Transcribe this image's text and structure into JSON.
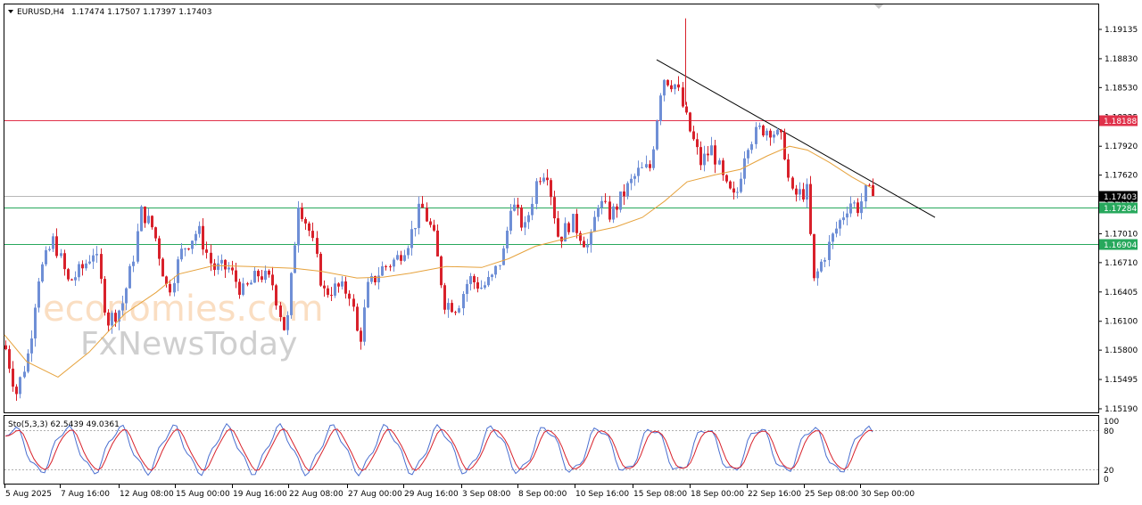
{
  "header": {
    "symbol": "EURUSD,H4",
    "ohlc": "1.17474 1.17507 1.17397 1.17403"
  },
  "watermark": {
    "line1": "economies.com",
    "line2": "FxNewsToday"
  },
  "oscillator": {
    "label": "Sto(5,3,3) 62.5439 49.0361",
    "levels": [
      "100",
      "80",
      "20",
      "0"
    ]
  },
  "colors": {
    "bull": "#6f8fd6",
    "bear": "#d8212b",
    "ma": "#e6a23c",
    "resistance_line": "#e0314a",
    "support_line": "#27a85c",
    "trendline": "#000000",
    "stoch_main": "#4a6fd0",
    "stoch_signal": "#d8212b"
  },
  "chart_data": {
    "type": "candlestick",
    "title": "EURUSD,H4",
    "y_ticks": [
      "1.19135",
      "1.18830",
      "1.18530",
      "1.18225",
      "1.17920",
      "1.17620",
      "1.17315",
      "1.17010",
      "1.16710",
      "1.16405",
      "1.16100",
      "1.15800",
      "1.15495",
      "1.15190"
    ],
    "x_ticks": [
      "5 Aug 2025",
      "7 Aug 16:00",
      "12 Aug 08:00",
      "15 Aug 00:00",
      "19 Aug 16:00",
      "22 Aug 08:00",
      "27 Aug 00:00",
      "29 Aug 16:00",
      "3 Sep 08:00",
      "8 Sep 00:00",
      "10 Sep 16:00",
      "15 Sep 08:00",
      "18 Sep 00:00",
      "22 Sep 16:00",
      "25 Sep 08:00",
      "30 Sep 00:00"
    ],
    "price_labels": [
      {
        "label": "1.18188",
        "value": 1.18188,
        "kind": "resistance"
      },
      {
        "label": "1.17403",
        "value": 1.17403,
        "kind": "current"
      },
      {
        "label": "1.17284",
        "value": 1.17284,
        "kind": "support"
      },
      {
        "label": "1.16904",
        "value": 1.16904,
        "kind": "support"
      }
    ],
    "trendline": {
      "from_x": 736,
      "from_price": 1.1882,
      "to_x": 1048,
      "to_price": 1.1718
    },
    "ylim": [
      1.1508,
      1.1938
    ],
    "keypoints": [
      [
        5,
        1.1585
      ],
      [
        18,
        1.1535
      ],
      [
        32,
        1.158
      ],
      [
        42,
        1.1655
      ],
      [
        60,
        1.1695
      ],
      [
        76,
        1.165
      ],
      [
        92,
        1.1665
      ],
      [
        106,
        1.1685
      ],
      [
        120,
        1.161
      ],
      [
        136,
        1.1625
      ],
      [
        148,
        1.167
      ],
      [
        158,
        1.1725
      ],
      [
        172,
        1.1705
      ],
      [
        188,
        1.164
      ],
      [
        204,
        1.1685
      ],
      [
        222,
        1.1705
      ],
      [
        238,
        1.1665
      ],
      [
        256,
        1.1665
      ],
      [
        272,
        1.164
      ],
      [
        290,
        1.166
      ],
      [
        305,
        1.165
      ],
      [
        320,
        1.1595
      ],
      [
        334,
        1.1735
      ],
      [
        348,
        1.17
      ],
      [
        362,
        1.164
      ],
      [
        378,
        1.1645
      ],
      [
        392,
        1.164
      ],
      [
        402,
        1.1585
      ],
      [
        412,
        1.1645
      ],
      [
        428,
        1.1665
      ],
      [
        444,
        1.1675
      ],
      [
        458,
        1.1695
      ],
      [
        472,
        1.173
      ],
      [
        485,
        1.17
      ],
      [
        498,
        1.163
      ],
      [
        512,
        1.1625
      ],
      [
        525,
        1.1655
      ],
      [
        540,
        1.1645
      ],
      [
        552,
        1.1655
      ],
      [
        565,
        1.1685
      ],
      [
        572,
        1.1735
      ],
      [
        588,
        1.1705
      ],
      [
        602,
        1.176
      ],
      [
        612,
        1.177
      ],
      [
        626,
        1.1695
      ],
      [
        640,
        1.1715
      ],
      [
        660,
        1.1685
      ],
      [
        670,
        1.1735
      ],
      [
        684,
        1.172
      ],
      [
        700,
        1.1745
      ],
      [
        715,
        1.1765
      ],
      [
        728,
        1.177
      ],
      [
        742,
        1.1865
      ],
      [
        758,
        1.1855
      ],
      [
        770,
        1.1815
      ],
      [
        785,
        1.1775
      ],
      [
        798,
        1.179
      ],
      [
        812,
        1.175
      ],
      [
        824,
        1.1735
      ],
      [
        836,
        1.1795
      ],
      [
        852,
        1.181
      ],
      [
        864,
        1.181
      ],
      [
        878,
        1.1795
      ],
      [
        886,
        1.174
      ],
      [
        904,
        1.1745
      ],
      [
        912,
        1.165
      ],
      [
        922,
        1.1675
      ],
      [
        936,
        1.1705
      ],
      [
        952,
        1.1735
      ],
      [
        962,
        1.1728
      ],
      [
        970,
        1.1745
      ],
      [
        978,
        1.17403
      ]
    ],
    "moving_average": [
      [
        5,
        1.1596
      ],
      [
        30,
        1.1568
      ],
      [
        65,
        1.1552
      ],
      [
        100,
        1.1578
      ],
      [
        140,
        1.1618
      ],
      [
        175,
        1.164
      ],
      [
        200,
        1.1659
      ],
      [
        240,
        1.1668
      ],
      [
        280,
        1.1667
      ],
      [
        330,
        1.1665
      ],
      [
        360,
        1.1662
      ],
      [
        400,
        1.1655
      ],
      [
        430,
        1.1656
      ],
      [
        460,
        1.166
      ],
      [
        500,
        1.1667
      ],
      [
        540,
        1.1666
      ],
      [
        570,
        1.1675
      ],
      [
        600,
        1.1688
      ],
      [
        630,
        1.1695
      ],
      [
        660,
        1.1702
      ],
      [
        690,
        1.1708
      ],
      [
        720,
        1.1718
      ],
      [
        745,
        1.1735
      ],
      [
        770,
        1.1755
      ],
      [
        800,
        1.1762
      ],
      [
        830,
        1.1768
      ],
      [
        860,
        1.1782
      ],
      [
        885,
        1.1792
      ],
      [
        905,
        1.1788
      ],
      [
        930,
        1.1775
      ],
      [
        955,
        1.176
      ],
      [
        978,
        1.1748
      ]
    ],
    "stochastic": {
      "main": 62.5439,
      "signal": 49.0361,
      "period": "5,3,3",
      "levels": [
        80,
        20
      ]
    }
  }
}
